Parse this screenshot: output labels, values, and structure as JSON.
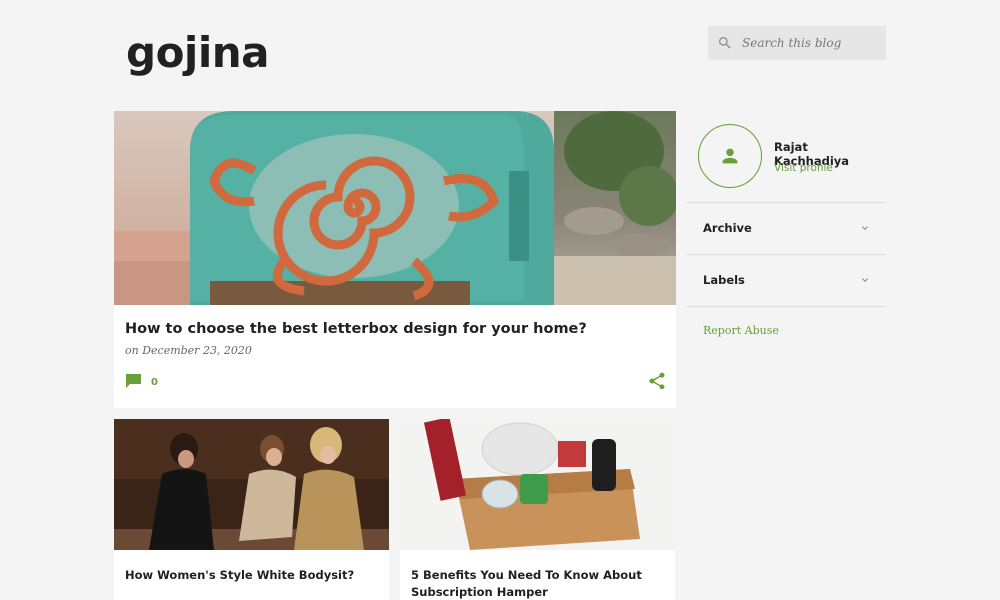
{
  "blog": {
    "title": "gojina"
  },
  "search": {
    "placeholder": "Search this blog",
    "icon": "search-icon"
  },
  "featured_post": {
    "title": "How to choose the best letterbox design for your home?",
    "date": "on December 23, 2020",
    "comment_count": "0",
    "image": "teal mailbox with orange spiral turtle painting"
  },
  "posts": [
    {
      "title": "How Women's Style White Bodysit?"
    },
    {
      "title": "5 Benefits You Need To Know About Subscription Hamper"
    }
  ],
  "sidebar": {
    "profile_name": "Rajat Kachhadiya",
    "visit_profile": "Visit profile",
    "widgets": [
      {
        "label": "Archive"
      },
      {
        "label": "Labels"
      }
    ],
    "report_abuse": "Report Abuse"
  },
  "colors": {
    "accent": "#689f38",
    "background": "#f4f4f4",
    "card": "#ffffff",
    "text": "#212121"
  }
}
